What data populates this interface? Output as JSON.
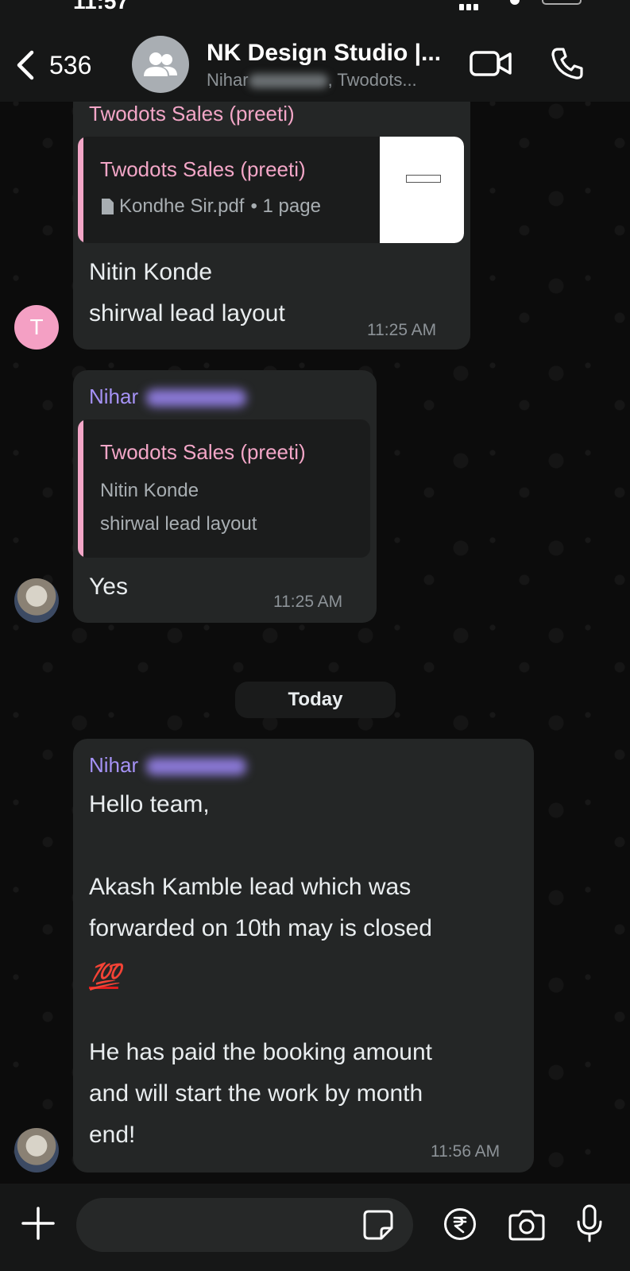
{
  "status_bar": {
    "time": "11:57"
  },
  "header": {
    "back_count": "536",
    "group_name": "NK Design Studio |...",
    "subtitle_first": "Nihar",
    "subtitle_rest": ", Twodots..."
  },
  "messages": [
    {
      "sender": "Twodots Sales (preeti)",
      "quote": {
        "author": "Twodots Sales (preeti)",
        "file_name": "Kondhe Sir.pdf",
        "file_meta": "• 1 page"
      },
      "lines": [
        "Nitin Konde",
        "shirwal lead layout"
      ],
      "time": "11:25 AM",
      "avatar_letter": "T"
    },
    {
      "sender": "Nihar",
      "quote": {
        "author": "Twodots Sales (preeti)",
        "lines": [
          "Nitin Konde",
          "shirwal lead layout"
        ]
      },
      "lines": [
        "Yes"
      ],
      "time": "11:25 AM"
    },
    {
      "sender": "Nihar",
      "lines": [
        "Hello team,",
        "Akash Kamble lead which was",
        "forwarded on 10th may is closed",
        "💯",
        "He has paid the booking amount",
        "and will start the work by month",
        "end!"
      ],
      "time": "11:56 AM"
    }
  ],
  "date_divider": "Today",
  "colors": {
    "pink_sender": "#f3a6c7",
    "purple_sender": "#a592f5",
    "bubble": "#242626",
    "header": "#161717"
  },
  "icons": {
    "back": "chevron-left-icon",
    "group": "group-icon",
    "video": "video-camera-icon",
    "phone": "phone-icon",
    "doc": "document-icon",
    "plus": "plus-icon",
    "sticker": "sticker-icon",
    "rupee": "rupee-icon",
    "camera": "camera-icon",
    "mic": "microphone-icon"
  }
}
